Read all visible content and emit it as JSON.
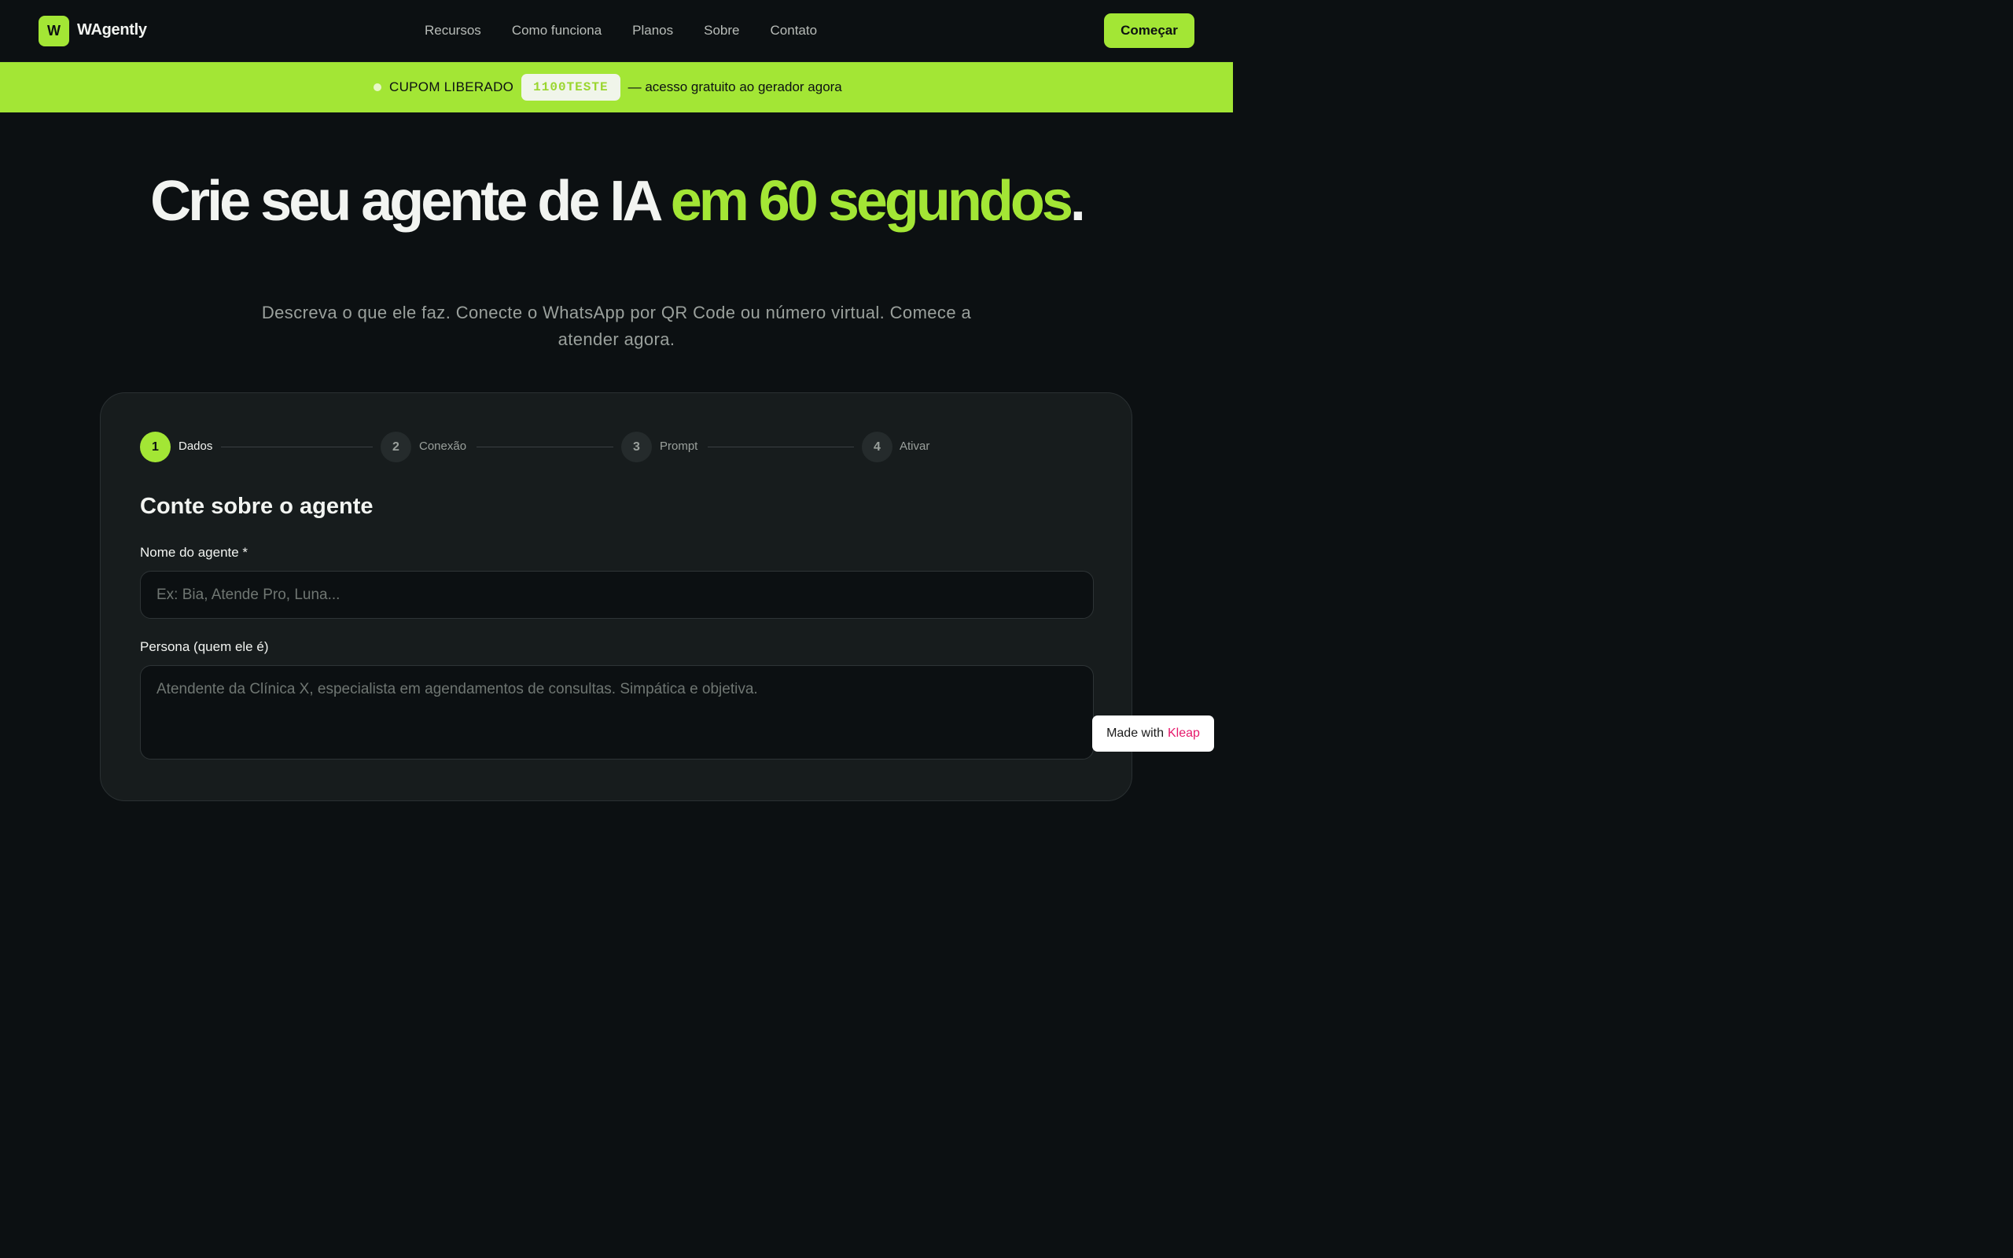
{
  "nav": {
    "logo_letter": "W",
    "brand": "WAgently",
    "links": [
      "Recursos",
      "Como funciona",
      "Planos",
      "Sobre",
      "Contato"
    ],
    "cta": "Começar"
  },
  "banner": {
    "label": "CUPOM LIBERADO",
    "code": "1100TESTE",
    "text": "— acesso gratuito ao gerador agora"
  },
  "hero": {
    "title_main": "Crie seu agente de IA ",
    "title_accent": "em 60 segundos",
    "title_end": ".",
    "subtitle": "Descreva o que ele faz. Conecte o WhatsApp por QR Code ou número virtual. Comece a atender agora."
  },
  "wizard": {
    "steps": [
      {
        "number": "1",
        "label": "Dados"
      },
      {
        "number": "2",
        "label": "Conexão"
      },
      {
        "number": "3",
        "label": "Prompt"
      },
      {
        "number": "4",
        "label": "Ativar"
      }
    ],
    "active_step": 1,
    "form_title": "Conte sobre o agente",
    "name_label": "Nome do agente *",
    "name_placeholder": "Ex: Bia, Atende Pro, Luna...",
    "name_value": "",
    "persona_label": "Persona (quem ele é)",
    "persona_placeholder": "Atendente da Clínica X, especialista em agendamentos de consultas. Simpática e objetiva.",
    "persona_value": ""
  },
  "badge": {
    "prefix": "Made with",
    "brand": "Kleap"
  },
  "colors": {
    "accent": "#a3e635",
    "background": "#0c1012",
    "card": "#171c1d",
    "badge_brand": "#e6186b"
  }
}
